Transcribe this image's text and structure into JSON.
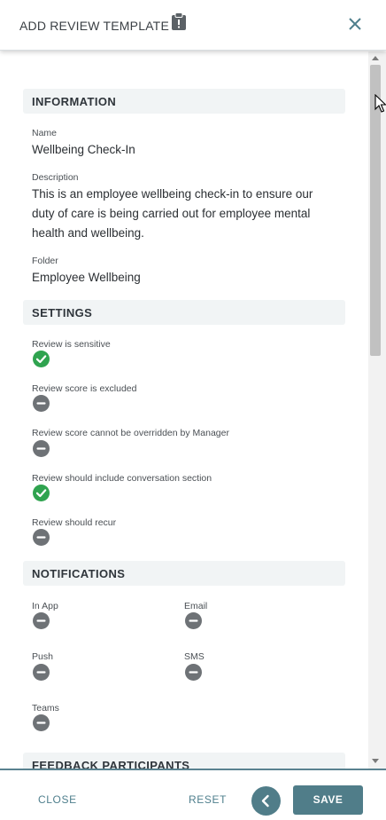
{
  "header": {
    "title": "ADD REVIEW TEMPLATE",
    "clipboard_icon": "clipboard-icon",
    "close_icon": "close-icon"
  },
  "information": {
    "heading": "INFORMATION",
    "name_label": "Name",
    "name_value": "Wellbeing Check-In",
    "description_label": "Description",
    "description_value": "This is an employee wellbeing check-in to ensure our duty of care is being carried out for employee mental health and wellbeing.",
    "folder_label": "Folder",
    "folder_value": "Employee Wellbeing"
  },
  "settings": {
    "heading": "SETTINGS",
    "items": [
      {
        "label": "Review is sensitive",
        "enabled": true
      },
      {
        "label": "Review score is excluded",
        "enabled": false
      },
      {
        "label": "Review score cannot be overridden by Manager",
        "enabled": false
      },
      {
        "label": "Review should include conversation section",
        "enabled": true
      },
      {
        "label": "Review should recur",
        "enabled": false
      }
    ]
  },
  "notifications": {
    "heading": "NOTIFICATIONS",
    "items": [
      {
        "label": "In App",
        "enabled": false
      },
      {
        "label": "Email",
        "enabled": false
      },
      {
        "label": "Push",
        "enabled": false
      },
      {
        "label": "SMS",
        "enabled": false
      },
      {
        "label": "Teams",
        "enabled": false
      }
    ]
  },
  "feedback": {
    "heading": "FEEDBACK PARTICIPANTS"
  },
  "footer": {
    "close_label": "CLOSE",
    "reset_label": "RESET",
    "back_icon": "chevron-left-icon",
    "save_label": "SAVE"
  },
  "colors": {
    "accent": "#507d89",
    "enabled": "#2fa34f",
    "disabled": "#6e7276",
    "section_bg": "#f1f4f5"
  }
}
